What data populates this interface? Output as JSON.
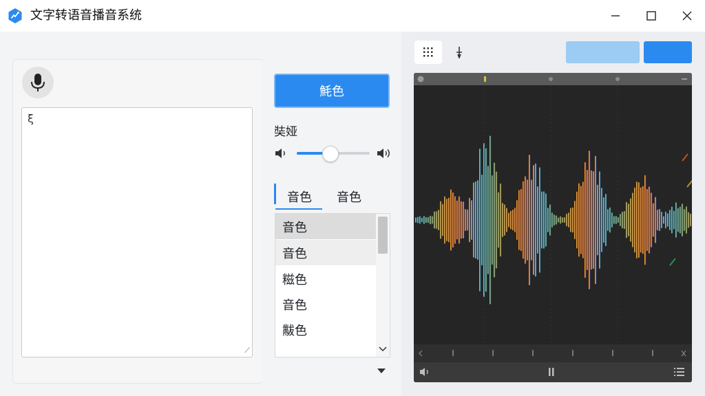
{
  "window": {
    "title": "文字转语音播音系统",
    "icon": "app-logo-icon",
    "controls": [
      "minimize-icon",
      "maximize-icon",
      "close-icon"
    ]
  },
  "input": {
    "mic_icon": "microphone-icon",
    "text_value": "ξ",
    "resize_glyph": "⟋"
  },
  "controls": {
    "primary_button": "魹色",
    "volume_label": "奘娅",
    "volume_low_icon": "volume-low-icon",
    "volume_high_icon": "volume-high-icon",
    "volume_level": 0.45,
    "tabs": [
      "音色",
      "音色"
    ],
    "active_tab": 0,
    "voices": [
      "音色",
      "音色",
      "糍色",
      "音色",
      "黻色"
    ],
    "selected_voice": 0,
    "hover_voice": 1,
    "dropdown_icon": "triangle-down-icon"
  },
  "visualizer": {
    "toolbar_icons": [
      "grid-icon",
      "pin-icon"
    ],
    "accent_light": "#9ccbf3",
    "accent": "#2b8af0",
    "background": "#252525",
    "spectrum_colors": [
      "#e53935",
      "#ff8c1a",
      "#fdd835",
      "#43a047",
      "#1e88e5",
      "#8e24aa"
    ],
    "footer_left_icon": "speaker-icon",
    "footer_center_icon": "pause-icon",
    "footer_right_icon": "list-icon"
  }
}
